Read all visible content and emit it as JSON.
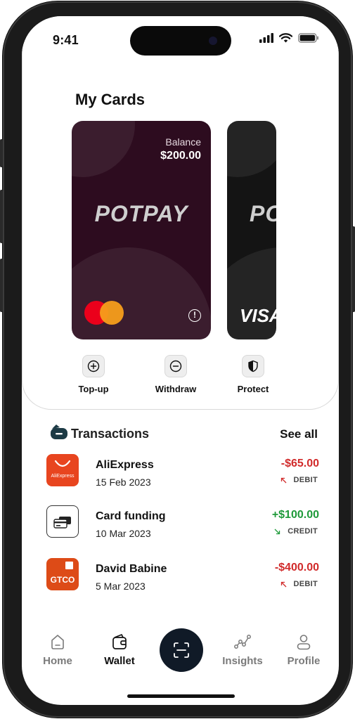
{
  "status_bar": {
    "time": "9:41"
  },
  "cards_section": {
    "title": "My Cards",
    "cards": [
      {
        "balance_label": "Balance",
        "balance_value": "$200.00",
        "brand": "POTPAY",
        "network": "mastercard"
      },
      {
        "brand": "PO",
        "network": "VISA"
      }
    ]
  },
  "actions": [
    {
      "label": "Top-up",
      "icon": "plus-circle-icon"
    },
    {
      "label": "Withdraw",
      "icon": "minus-circle-icon"
    },
    {
      "label": "Protect",
      "icon": "shield-icon"
    }
  ],
  "transactions": {
    "title": "Transactions",
    "see_all": "See all",
    "items": [
      {
        "name": "AliExpress",
        "date": "15 Feb 2023",
        "amount": "-$65.00",
        "type": "DEBIT",
        "logo_text": "AliExpress"
      },
      {
        "name": "Card funding",
        "date": "10 Mar 2023",
        "amount": "+$100.00",
        "type": "CREDIT"
      },
      {
        "name": "David Babine",
        "date": "5 Mar 2023",
        "amount": "-$400.00",
        "type": "DEBIT",
        "logo_text": "GTCO"
      }
    ]
  },
  "tab_bar": {
    "tabs": [
      {
        "label": "Home",
        "icon": "home-icon"
      },
      {
        "label": "Wallet",
        "icon": "wallet-icon"
      },
      {
        "label": "Insights",
        "icon": "insights-icon"
      },
      {
        "label": "Profile",
        "icon": "profile-icon"
      }
    ],
    "scan": {
      "icon": "scan-icon"
    }
  },
  "colors": {
    "card_primary": "#2d0c1f",
    "card_secondary": "#141414",
    "debit": "#d12b2b",
    "credit": "#1f9a3a",
    "scan_button": "#101a27"
  }
}
